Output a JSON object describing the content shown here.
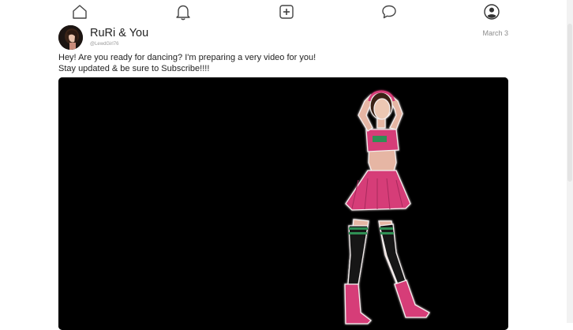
{
  "nav": {
    "items": [
      {
        "name": "home"
      },
      {
        "name": "notifications"
      },
      {
        "name": "create-post"
      },
      {
        "name": "messages"
      },
      {
        "name": "profile"
      }
    ]
  },
  "post": {
    "author": "RuRi & You",
    "handle": "@LewdGirl76",
    "date": "March 3",
    "text_line1": "Hey! Are you ready for dancing? I'm preparing a very video for you!",
    "text_line2": "Stay updated & be sure to Subscribe!!!!",
    "media_type": "image"
  },
  "colors": {
    "background": "#ffffff",
    "media_background": "#000000",
    "outfit_pink": "#d63c78",
    "sock_stripe_green": "#2f8f54"
  }
}
